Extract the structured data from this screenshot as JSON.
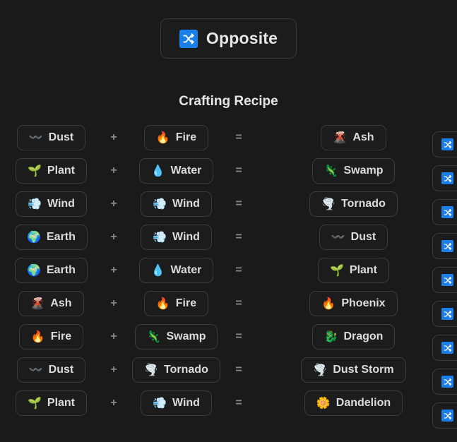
{
  "toolbar": {
    "opposite_label": "Opposite",
    "opposite_icon": "shuffle-icon"
  },
  "section": {
    "title": "Crafting Recipe"
  },
  "separators": {
    "plus": "+",
    "equals": "="
  },
  "colors": {
    "background": "#1a1a1a",
    "chip_background": "#1c1c1c",
    "chip_border": "#3c3c3c",
    "text": "#dcdcdc",
    "separator": "#8a8a8a",
    "accent_blue": "#1a7fe8"
  },
  "recipes": [
    {
      "a": {
        "label": "Dust",
        "emoji": "〰️"
      },
      "b": {
        "label": "Fire",
        "emoji": "🔥"
      },
      "result": {
        "label": "Ash",
        "emoji": "🌋"
      }
    },
    {
      "a": {
        "label": "Plant",
        "emoji": "🌱"
      },
      "b": {
        "label": "Water",
        "emoji": "💧"
      },
      "result": {
        "label": "Swamp",
        "emoji": "🦎"
      }
    },
    {
      "a": {
        "label": "Wind",
        "emoji": "💨"
      },
      "b": {
        "label": "Wind",
        "emoji": "💨"
      },
      "result": {
        "label": "Tornado",
        "emoji": "🌪️"
      }
    },
    {
      "a": {
        "label": "Earth",
        "emoji": "🌍"
      },
      "b": {
        "label": "Wind",
        "emoji": "💨"
      },
      "result": {
        "label": "Dust",
        "emoji": "〰️"
      }
    },
    {
      "a": {
        "label": "Earth",
        "emoji": "🌍"
      },
      "b": {
        "label": "Water",
        "emoji": "💧"
      },
      "result": {
        "label": "Plant",
        "emoji": "🌱"
      }
    },
    {
      "a": {
        "label": "Ash",
        "emoji": "🌋"
      },
      "b": {
        "label": "Fire",
        "emoji": "🔥"
      },
      "result": {
        "label": "Phoenix",
        "emoji": "🔥"
      }
    },
    {
      "a": {
        "label": "Fire",
        "emoji": "🔥"
      },
      "b": {
        "label": "Swamp",
        "emoji": "🦎"
      },
      "result": {
        "label": "Dragon",
        "emoji": "🐉"
      }
    },
    {
      "a": {
        "label": "Dust",
        "emoji": "〰️"
      },
      "b": {
        "label": "Tornado",
        "emoji": "🌪️"
      },
      "result": {
        "label": "Dust Storm",
        "emoji": "🌪️"
      }
    },
    {
      "a": {
        "label": "Plant",
        "emoji": "🌱"
      },
      "b": {
        "label": "Wind",
        "emoji": "💨"
      },
      "result": {
        "label": "Dandelion",
        "emoji": "🌼"
      }
    }
  ],
  "right_column": {
    "icon": "shuffle-icon",
    "count": 9
  }
}
